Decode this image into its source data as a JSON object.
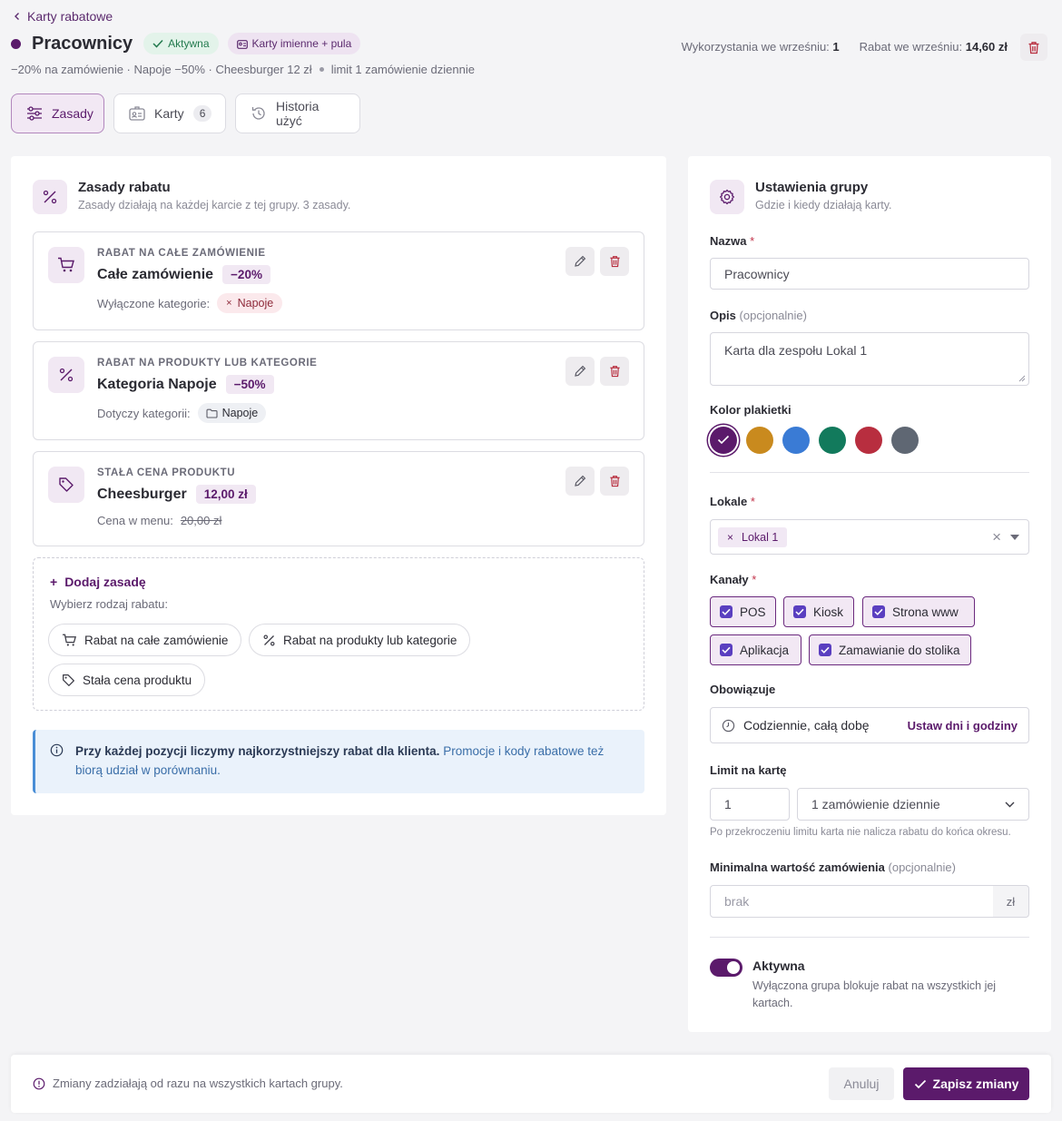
{
  "breadcrumb": {
    "back_label": "Karty rabatowe"
  },
  "header": {
    "title": "Pracownicy",
    "status_badge": "Aktywna",
    "type_badge": "Karty imienne + pula",
    "summary": "−20% na zamówienie · Napoje −50% · Cheesburger 12 zł",
    "summary_limit": "limit 1 zamówienie dziennie",
    "stats": {
      "uses_label": "Wykorzystania we wrześniu:",
      "uses_value": "1",
      "discount_label": "Rabat we wrześniu:",
      "discount_value": "14,60 zł"
    }
  },
  "tabs": [
    {
      "label": "Zasady",
      "active": true
    },
    {
      "label": "Karty",
      "count": "6"
    },
    {
      "label": "Historia użyć"
    }
  ],
  "rules_section": {
    "title": "Zasady rabatu",
    "subtitle": "Zasady działają na każdej karcie z tej grupy. 3 zasady.",
    "rules": [
      {
        "kind": "RABAT NA CAŁE ZAMÓWIENIE",
        "name": "Całe zamówienie",
        "value": "−20%",
        "meta_label": "Wyłączone kategorie:",
        "meta_chip": "Napoje",
        "icon": "cart-icon"
      },
      {
        "kind": "RABAT NA PRODUKTY LUB KATEGORIE",
        "name": "Kategoria Napoje",
        "value": "−50%",
        "meta_label": "Dotyczy kategorii:",
        "meta_chip": "Napoje",
        "icon": "percent-icon"
      },
      {
        "kind": "STAŁA CENA PRODUKTU",
        "name": "Cheesburger",
        "value": "12,00 zł",
        "meta_label": "Cena w menu:",
        "meta_price": "20,00 zł",
        "icon": "tag-icon"
      }
    ],
    "add": {
      "title": "Dodaj zasadę",
      "subtitle": "Wybierz rodzaj rabatu:",
      "options": [
        "Rabat na całe zamówienie",
        "Rabat na produkty lub kategorie",
        "Stała cena produktu"
      ]
    },
    "info_bold": "Przy każdej pozycji liczymy najkorzystniejszy rabat dla klienta.",
    "info_text": "Promocje i kody rabatowe też biorą udział w porównaniu."
  },
  "settings": {
    "title": "Ustawienia grupy",
    "subtitle": "Gdzie i kiedy działają karty.",
    "name_label": "Nazwa",
    "name_value": "Pracownicy",
    "desc_label": "Opis",
    "desc_optional": "(opcjonalnie)",
    "desc_value": "Karta dla zespołu Lokal 1",
    "color_label": "Kolor plakietki",
    "colors": [
      "#5b1a6b",
      "#c98a1e",
      "#3a7bd5",
      "#127a5c",
      "#b82e3f",
      "#5f6773"
    ],
    "locations_label": "Lokale",
    "locations": [
      "Lokal 1"
    ],
    "channels_label": "Kanały",
    "channels": [
      "POS",
      "Kiosk",
      "Strona www",
      "Aplikacja",
      "Zamawianie do stolika"
    ],
    "validity_label": "Obowiązuje",
    "validity_value": "Codziennie, całą dobę",
    "validity_link": "Ustaw dni i godziny",
    "limit_label": "Limit na kartę",
    "limit_value": "1",
    "limit_period": "1 zamówienie dziennie",
    "limit_hint": "Po przekroczeniu limitu karta nie nalicza rabatu do końca okresu.",
    "min_label": "Minimalna wartość zamówienia",
    "min_optional": "(opcjonalnie)",
    "min_placeholder": "brak",
    "min_unit": "zł",
    "active_label": "Aktywna",
    "active_desc_1": "Wyłączona grupa blokuje rabat na wszystkich jej",
    "active_desc_2": "kartach."
  },
  "footer": {
    "info": "Zmiany zadziałają od razu na wszystkich kartach grupy.",
    "cancel": "Anuluj",
    "save": "Zapisz zmiany"
  }
}
